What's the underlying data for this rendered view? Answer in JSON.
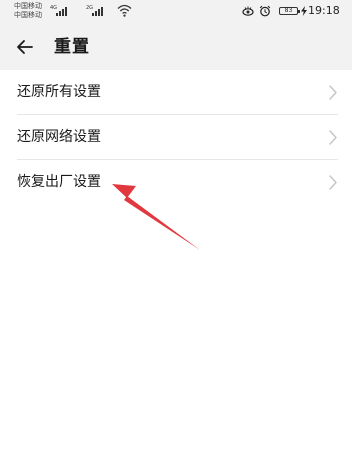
{
  "status_bar": {
    "carrier_1": "中国移动",
    "carrier_2": "中国移动",
    "sim1_tag": "4G",
    "sim2_tag": "2G",
    "battery_level": "83",
    "time": "19:18",
    "icons": [
      "signal-icon",
      "wifi-icon",
      "eye-comfort-icon",
      "alarm-icon",
      "battery-icon",
      "charging-icon"
    ]
  },
  "header": {
    "back_icon": "arrow-left-icon",
    "title": "重置"
  },
  "menu": {
    "items": [
      {
        "label": "还原所有设置"
      },
      {
        "label": "还原网络设置"
      },
      {
        "label": "恢复出厂设置"
      }
    ]
  },
  "colors": {
    "background": "#f2f2f2",
    "surface": "#ffffff",
    "annotation_arrow": "#e0383e"
  }
}
